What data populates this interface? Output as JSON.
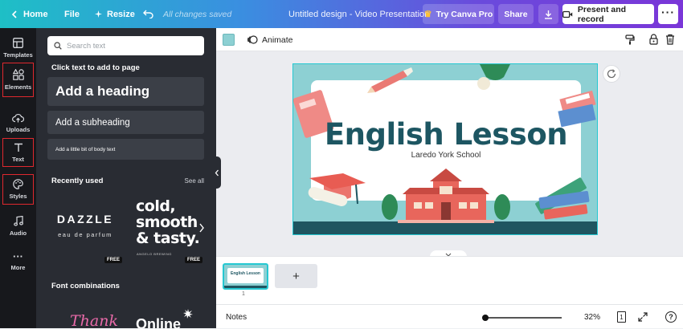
{
  "topbar": {
    "home_label": "Home",
    "file_label": "File",
    "resize_label": "Resize",
    "saved_status": "All changes saved",
    "doc_title": "Untitled design - Video Presentation",
    "pro_label": "Try Canva Pro",
    "share_label": "Share",
    "present_label": "Present and record"
  },
  "rail": {
    "items": [
      {
        "label": "Templates"
      },
      {
        "label": "Elements"
      },
      {
        "label": "Uploads"
      },
      {
        "label": "Text"
      },
      {
        "label": "Styles"
      },
      {
        "label": "Audio"
      },
      {
        "label": "More"
      }
    ]
  },
  "panel": {
    "search_placeholder": "Search text",
    "click_text": "Click text to add to page",
    "heading_label": "Add a heading",
    "subheading_label": "Add a subheading",
    "body_label": "Add a little bit of body text",
    "recently_used": "Recently used",
    "see_all": "See all",
    "tiles": [
      {
        "line1": "DAZZLE",
        "line2": "eau de parfum",
        "badge": "FREE"
      },
      {
        "line1": "cold,",
        "line2": "smooth",
        "line3": "& tasty.",
        "small": "ANGELO BREWING",
        "badge": "FREE"
      }
    ],
    "font_combinations": "Font combinations",
    "combo_tiles": [
      {
        "text": "Thank"
      },
      {
        "text": "Online"
      }
    ]
  },
  "toolbar": {
    "animate_label": "Animate",
    "color_swatch": "#8dd0d3"
  },
  "slide": {
    "title": "English Lesson",
    "subtitle": "Laredo York School"
  },
  "pages": {
    "thumb_title": "English Lesson",
    "page_number": "1",
    "add_label": "+"
  },
  "footer": {
    "notes_label": "Notes",
    "zoom": "32%",
    "zoom_fraction": 0.32,
    "page_count": "1",
    "help_label": "?"
  },
  "colors": {
    "accent": "#7a36d8",
    "slide_teal": "#8dd0d3",
    "slide_dark": "#1d5662",
    "panel": "#292c33",
    "rail": "#17181c",
    "highlight": "#e0282e"
  }
}
